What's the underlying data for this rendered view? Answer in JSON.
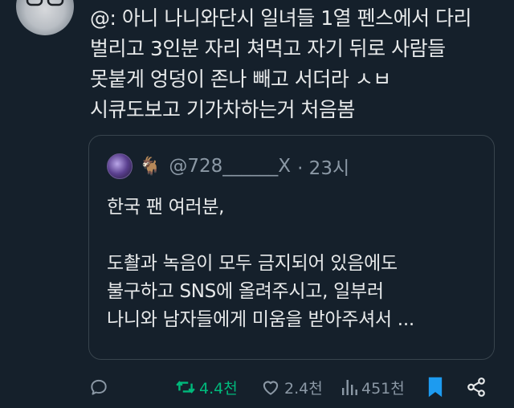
{
  "tweet": {
    "lines": [
      "@: 아니 나니와단시 일녀들 1열 펜스에서 다리",
      "벌리고 3인분 자리 쳐먹고 자기 뒤로 사람들",
      "못붙게 엉덩이 존나 빼고 서더라 ㅅㅂ",
      "시큐도보고 기가차하는거 처음봄"
    ]
  },
  "quote": {
    "author_emoji": "🐐",
    "handle": "@728______X",
    "time": "· 23시",
    "lines": [
      "한국 팬 여러분,",
      "",
      " 도촬과 녹음이 모두 금지되어 있음에도",
      "불구하고 SNS에 올려주시고, 일부러",
      "나니와 남자들에게 미움을 받아주셔서 ..."
    ]
  },
  "actions": {
    "retweets": "4.4천",
    "likes": "2.4천",
    "views": "451천"
  },
  "colors": {
    "background": "#15202b",
    "text": "#e7e9ea",
    "muted": "#8b98a5",
    "retweet_active": "#00ba7c",
    "bookmark_active": "#1d9bf0",
    "border": "#38444d"
  }
}
